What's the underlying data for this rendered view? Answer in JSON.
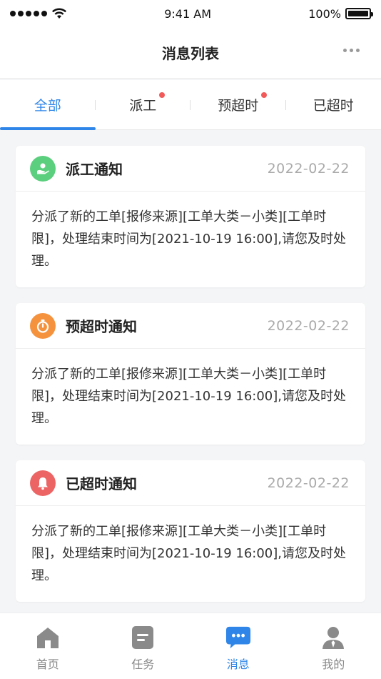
{
  "status_bar": {
    "time": "9:41 AM",
    "battery": "100%"
  },
  "nav": {
    "title": "消息列表"
  },
  "tabs": [
    {
      "label": "全部",
      "active": true,
      "dot": false
    },
    {
      "label": "派工",
      "active": false,
      "dot": true
    },
    {
      "label": "预超时",
      "active": false,
      "dot": true
    },
    {
      "label": "已超时",
      "active": false,
      "dot": false
    }
  ],
  "messages": [
    {
      "title": "派工通知",
      "date": "2022-02-22",
      "icon": "dispatch-icon",
      "icon_color": "#5ccf7e",
      "body": "分派了新的工单[报修来源][工单大类－小类][工单时限]，处理结束时间为[2021-10-19 16:00],请您及时处理。"
    },
    {
      "title": "预超时通知",
      "date": "2022-02-22",
      "icon": "timer-icon",
      "icon_color": "#f5923e",
      "body": "分派了新的工单[报修来源][工单大类－小类][工单时限]，处理结束时间为[2021-10-19 16:00],请您及时处理。"
    },
    {
      "title": "已超时通知",
      "date": "2022-02-22",
      "icon": "bell-icon",
      "icon_color": "#ec6464",
      "body": "分派了新的工单[报修来源][工单大类－小类][工单时限]，处理结束时间为[2021-10-19 16:00],请您及时处理。"
    }
  ],
  "tabbar": [
    {
      "label": "首页",
      "icon": "home-icon",
      "active": false
    },
    {
      "label": "任务",
      "icon": "task-icon",
      "active": false
    },
    {
      "label": "消息",
      "icon": "message-icon",
      "active": true
    },
    {
      "label": "我的",
      "icon": "profile-icon",
      "active": false
    }
  ],
  "colors": {
    "accent": "#2f86e8",
    "dot": "#f25a5a",
    "inactive_icon": "#8a8a8a"
  }
}
